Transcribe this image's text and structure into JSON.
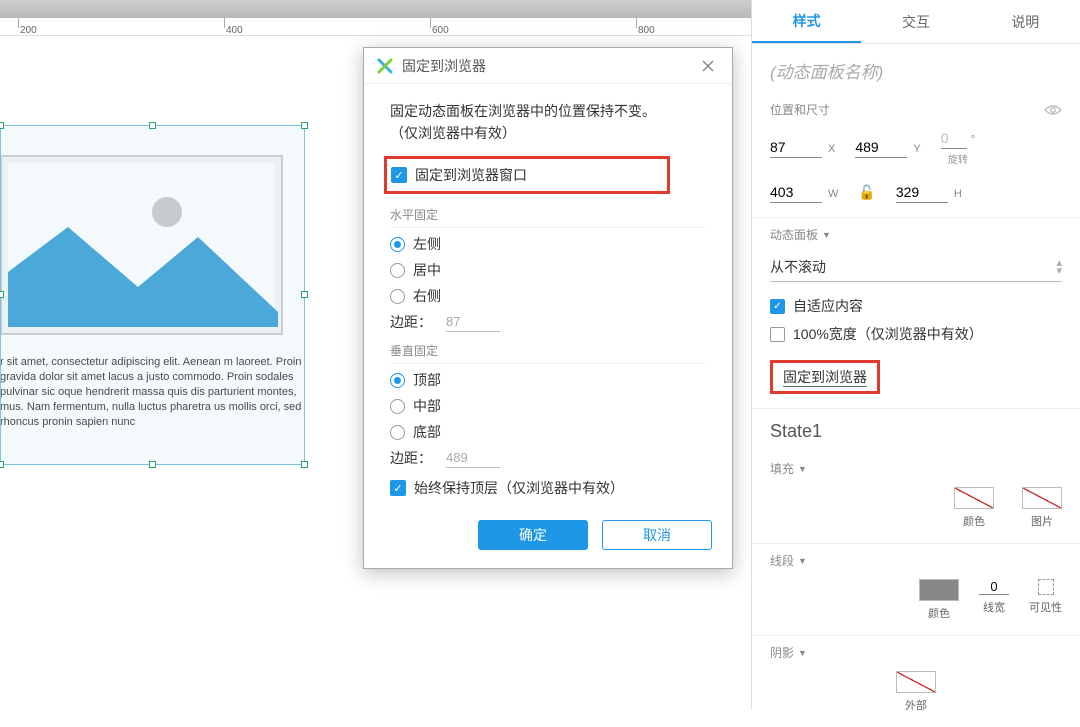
{
  "ruler": {
    "t200": "200",
    "t400": "400",
    "t600": "600",
    "t800": "800"
  },
  "canvas": {
    "lorem": "r sit amet, consectetur adipiscing elit. Aenean m laoreet. Proin gravida dolor sit amet lacus a justo commodo. Proin sodales pulvinar sic oque hendrerit massa quis dis parturient montes, mus. Nam fermentum, nulla luctus pharetra us mollis orci, sed rhoncus pronin sapien nunc"
  },
  "dialog": {
    "title": "固定到浏览器",
    "desc_line1": "固定动态面板在浏览器中的位置保持不变。",
    "desc_line2": "（仅浏览器中有效）",
    "pin_checkbox": "固定到浏览器窗口",
    "h_head": "水平固定",
    "h_left": "左侧",
    "h_center": "居中",
    "h_right": "右侧",
    "margin_label": "边距：",
    "h_margin": "87",
    "v_head": "垂直固定",
    "v_top": "顶部",
    "v_middle": "中部",
    "v_bottom": "底部",
    "v_margin": "489",
    "keep_front": "始终保持顶层（仅浏览器中有效）",
    "ok": "确定",
    "cancel": "取消"
  },
  "panel": {
    "tab_style": "样式",
    "tab_interact": "交互",
    "tab_notes": "说明",
    "name_placeholder": "(动态面板名称)",
    "pos_head": "位置和尺寸",
    "x": "87",
    "xl": "X",
    "y": "489",
    "yl": "Y",
    "r": "0",
    "rl": "°",
    "r_lbl": "旋转",
    "w": "403",
    "wl": "W",
    "h": "329",
    "hl": "H",
    "dp_head": "动态面板",
    "scroll": "从不滚动",
    "fit": "自适应内容",
    "full_w": "100%宽度（仅浏览器中有效）",
    "pin_link": "固定到浏览器",
    "state": "State1",
    "fill_head": "填充",
    "fill_color": "颜色",
    "fill_img": "图片",
    "line_head": "线段",
    "line_color": "颜色",
    "line_w": "0",
    "line_w_lbl": "线宽",
    "line_vis": "可见性",
    "shadow_head": "阴影",
    "shadow_outer": "外部"
  }
}
